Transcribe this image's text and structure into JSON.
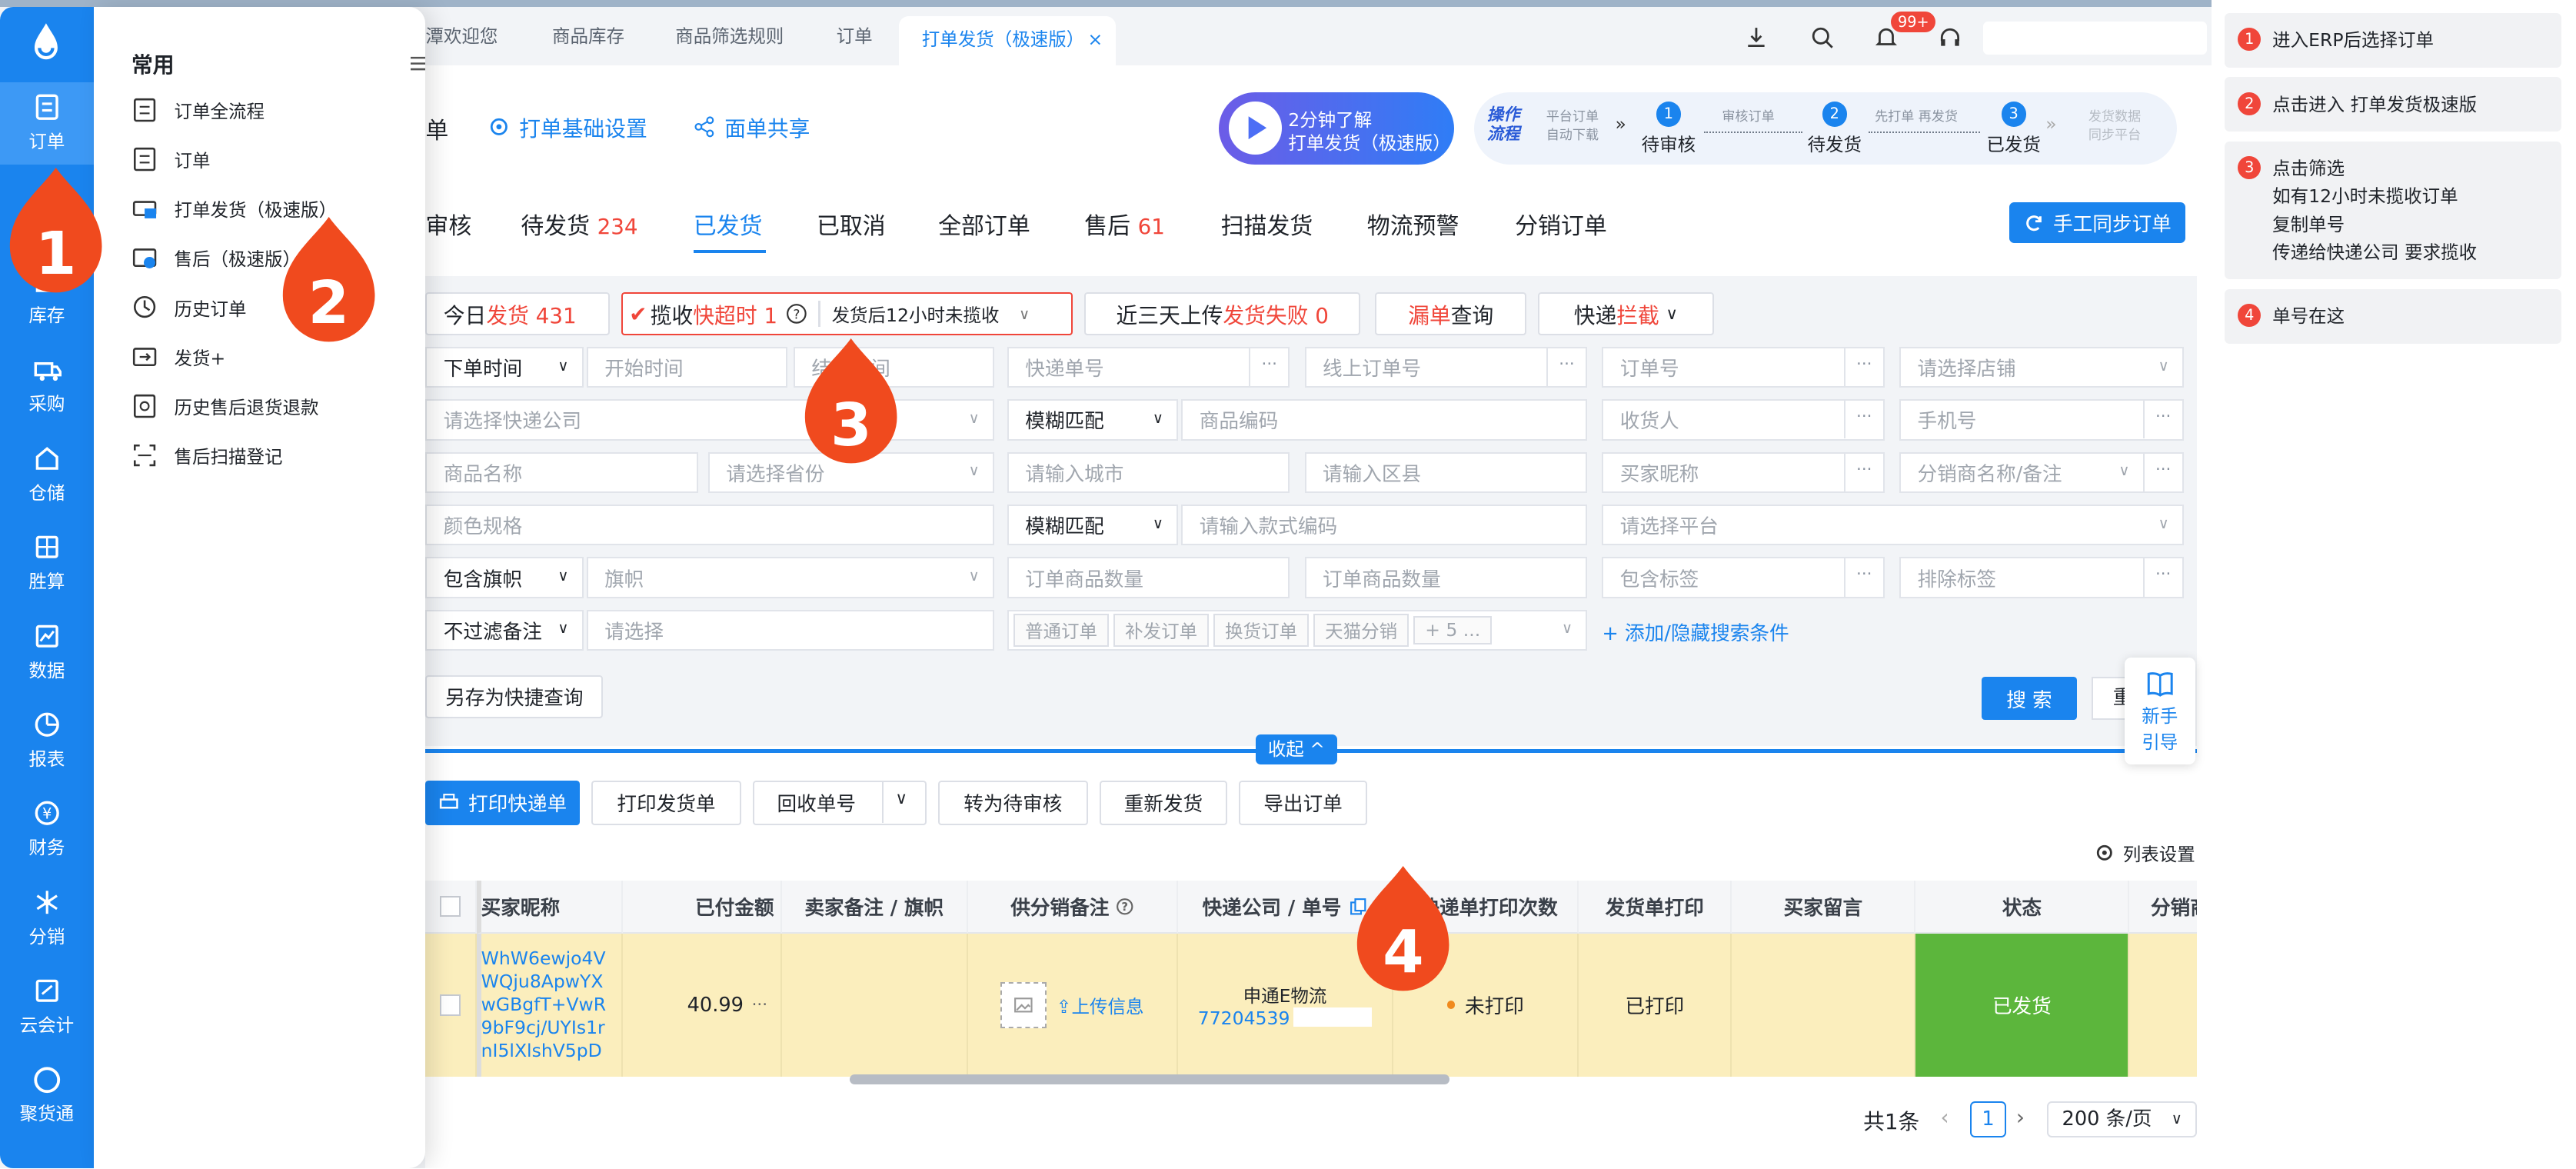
{
  "sidebar": {
    "items": [
      {
        "label": "订单",
        "icon": "order-icon"
      },
      {
        "label": "库存",
        "icon": "inventory-icon"
      },
      {
        "label": "采购",
        "icon": "purchase-icon"
      },
      {
        "label": "仓储",
        "icon": "warehouse-icon"
      },
      {
        "label": "胜算",
        "icon": "calculator-icon"
      },
      {
        "label": "数据",
        "icon": "chart-icon"
      },
      {
        "label": "报表",
        "icon": "pie-chart-icon"
      },
      {
        "label": "财务",
        "icon": "finance-icon"
      },
      {
        "label": "分销",
        "icon": "distribution-icon"
      },
      {
        "label": "云会计",
        "icon": "accounting-icon"
      },
      {
        "label": "聚货通",
        "icon": "circle-icon"
      }
    ]
  },
  "flyout": {
    "heading": "常用",
    "items": [
      "订单全流程",
      "订单",
      "打单发货（极速版）",
      "售后（极速版）",
      "历史订单",
      "发货+",
      "历史售后退货退款",
      "售后扫描登记"
    ]
  },
  "tabs": [
    "潭欢迎您",
    "商品库存",
    "商品筛选规则",
    "订单",
    "打单发货（极速版）"
  ],
  "top": {
    "badge": "99+"
  },
  "header": {
    "title": "单",
    "settings_link": "打单基础设置",
    "share_link": "面单共享",
    "promo_line1": "2分钟了解",
    "promo_line2": "打单发货（极速版）",
    "flow_label": "操作流程",
    "flow": {
      "pre1": "平台订单",
      "pre2": "自动下载",
      "s1": "待审核",
      "a1": "审核订单",
      "s2": "待发货",
      "a2": "先打单 再发货",
      "s3": "已发货",
      "post1": "发货数据",
      "post2": "同步平台"
    }
  },
  "subtabs": [
    {
      "label": "审核",
      "num": ""
    },
    {
      "label": "待发货",
      "num": "234"
    },
    {
      "label": "已发货",
      "num": ""
    },
    {
      "label": "已取消",
      "num": ""
    },
    {
      "label": "全部订单",
      "num": ""
    },
    {
      "label": "售后",
      "num": "61"
    },
    {
      "label": "扫描发货",
      "num": ""
    },
    {
      "label": "物流预警",
      "num": ""
    },
    {
      "label": "分销订单",
      "num": ""
    }
  ],
  "sync_button": "手工同步订单",
  "quick": {
    "today_a": "今日",
    "today_b": "发货 431",
    "overtime_a": "揽收",
    "overtime_b": "快超时 1",
    "overtime_select": "发货后12小时未揽收",
    "upload_a": "近三天上传",
    "upload_b": "发货失败 0",
    "miss_a": "漏单",
    "miss_b": "查询",
    "intercept_a": "快递",
    "intercept_b": "拦截"
  },
  "filters": {
    "time_type": "下单时间",
    "start_time": "开始时间",
    "end_time": "结束时间",
    "express_no": "快递单号",
    "online_order": "线上订单号",
    "order_no": "订单号",
    "shop": "请选择店铺",
    "express_company": "请选择快递公司",
    "fuzzy1": "模糊匹配",
    "goods_code": "商品编码",
    "receiver": "收货人",
    "phone": "手机号",
    "goods_name": "商品名称",
    "province": "请选择省份",
    "city": "请输入城市",
    "district": "请输入区县",
    "buyer_nick": "买家昵称",
    "distributor": "分销商名称/备注",
    "spec": "颜色规格",
    "fuzzy2": "模糊匹配",
    "style_code": "请输入款式编码",
    "platform": "请选择平台",
    "flag_type": "包含旗帜",
    "flag": "旗帜",
    "qty_from": "订单商品数量",
    "qty_to": "订单商品数量",
    "include_tag": "包含标签",
    "exclude_tag": "排除标签",
    "remark_type": "不过滤备注",
    "remark_select": "请选择",
    "chips": [
      "普通订单",
      "补发订单",
      "换货订单",
      "天猫分销",
      "+ 5 ..."
    ],
    "add_link": "+ 添加/隐藏搜索条件"
  },
  "buttons": {
    "save_query": "另存为快捷查询",
    "search": "搜 索",
    "reset": "重置",
    "collapse": "收起",
    "guide1": "新手",
    "guide2": "引导"
  },
  "actions": [
    "打印快递单",
    "打印发货单",
    "回收单号",
    "转为待审核",
    "重新发货",
    "导出订单"
  ],
  "list_settings": "列表设置",
  "table": {
    "headers": [
      "买家昵称",
      "已付金额",
      "卖家备注 / 旗帜",
      "供分销备注",
      "快递公司 / 单号",
      "快递单打印次数",
      "发货单打印",
      "买家留言",
      "状态",
      "分销商"
    ],
    "row": {
      "nick": [
        "WhW6ewjo4V",
        "WQju8ApwYX",
        "wGBgfT+VwR",
        "9bF9cj/UYIs1r",
        "nI5lXlshV5pD"
      ],
      "paid": "40.99",
      "upload": "上传信息",
      "express": "申通E物流",
      "tracking": "77204539",
      "print_count": "未打印",
      "ship_print": "已打印",
      "status": "已发货"
    }
  },
  "pagination": {
    "total": "共1条",
    "page": "1",
    "size": "200 条/页"
  },
  "callouts": [
    "1",
    "2",
    "3",
    "4"
  ],
  "panel": {
    "steps": [
      {
        "n": "1",
        "lines": [
          "进入ERP后选择订单"
        ]
      },
      {
        "n": "2",
        "lines": [
          "点击进入 打单发货极速版"
        ]
      },
      {
        "n": "3",
        "lines": [
          "点击筛选",
          "如有12小时未揽收订单",
          "复制单号",
          "传递给快递公司 要求揽收"
        ]
      },
      {
        "n": "4",
        "lines": [
          "单号在这"
        ]
      }
    ]
  },
  "colors": {
    "primary": "#1a84ee",
    "accent_red": "#f0463a",
    "row_highlight": "#fbeebd",
    "status_green": "#5cb63c",
    "callout": "#f04a1e"
  }
}
